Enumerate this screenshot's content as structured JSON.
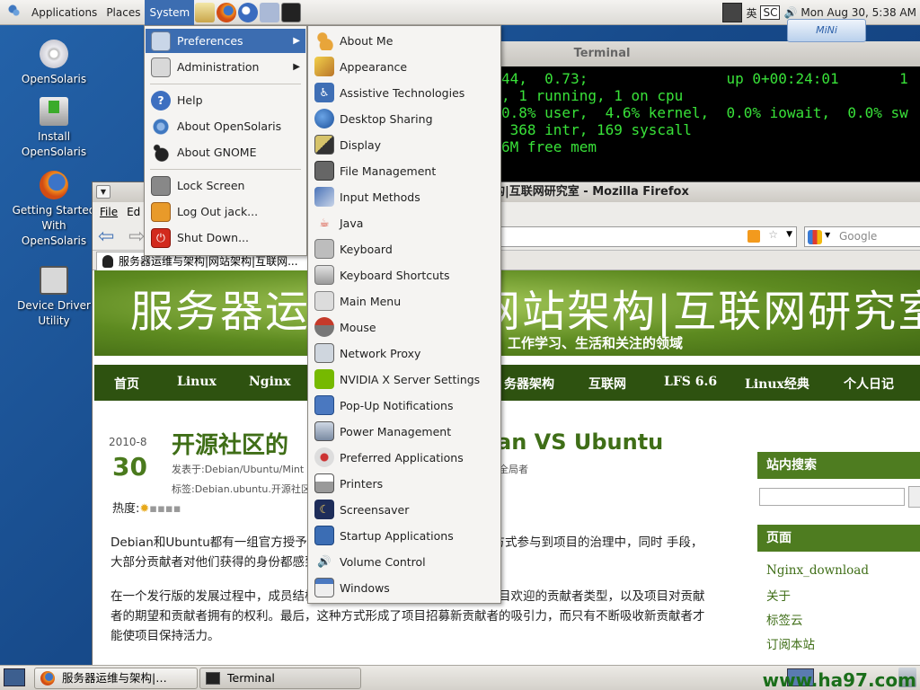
{
  "top_panel": {
    "applications_label": "Applications",
    "places_label": "Places",
    "system_label": "System",
    "ime_label": "英",
    "sc_label": "SC",
    "clock": "Mon Aug 30,  5:38 AM",
    "mini_label": "MiNi"
  },
  "desktop_icons": [
    {
      "label": "OpenSolaris",
      "icon": "cd-icon"
    },
    {
      "label": "Install OpenSolaris",
      "icon": "install-icon"
    },
    {
      "label": "Getting Started With OpenSolaris",
      "icon": "firefox-icon"
    },
    {
      "label": "Device Driver Utility",
      "icon": "device-driver-icon"
    }
  ],
  "terminal": {
    "title": "Terminal",
    "lines": [
      "44,  0.73;                up 0+00:24:01       1",
      ", 1 running, 1 on cpu",
      "0.8% user,  4.6% kernel,  0.0% iowait,  0.0% sw",
      " 368 intr, 169 syscall",
      "6M free mem"
    ]
  },
  "firefox": {
    "title_suffix": "构|互联网研究室 - Mozilla Firefox",
    "menu_file": "File",
    "menu_edit": "Ed",
    "search_placeholder": "Google",
    "tab_label": "服务器运维与架构|网站架构|互联网...",
    "site_title_left": "服务器运",
    "site_title_right": "网站架构|互联网研究室",
    "site_subtitle": "工作学习、生活和关注的领域",
    "nav": [
      "首页",
      "Linux",
      "Nginx",
      "务器架构",
      "互联网",
      "LFS 6.6",
      "Linux经典",
      "个人日记"
    ],
    "post_year_month": "2010-8",
    "post_day": "30",
    "post_title_left": "开源社区的",
    "post_title_right": "an VS Ubuntu",
    "post_meta_posted": "发表于:Debian/Ubuntu/Mint",
    "post_meta_tags": "标签:Debian.ubuntu.开源社区",
    "post_meta_author": "全局者",
    "post_heat_label": "热度:",
    "post_para1": "Debian和Ubuntu都有一组官方授予                          可以以参加选举或其他官方决策等方式参与到项目的治理中，同时                          手段，大部分贡献者对他们获得的身份都感到很自豪。",
    "post_para2": "在一个发行版的发展过程中，成员结构扮演中重要的角色：它定义了受项目欢迎的贡献者类型，以及项目对贡献者的期望和贡献者拥有的权利。最后，这种方式形成了项目招募新贡献者的吸引力，而只有不断吸收新贡献者才能使项目保持活力。",
    "sidebar_search_title": "站内搜索",
    "sidebar_pages_title": "页面",
    "sidebar_links": [
      "Nginx_download",
      "关于",
      "标签云",
      "订阅本站"
    ]
  },
  "system_menu": {
    "items": [
      {
        "label": "Preferences",
        "icon": "preferences-icon",
        "submenu": true
      },
      {
        "label": "Administration",
        "icon": "administration-icon",
        "submenu": true
      },
      {
        "label": "Help",
        "icon": "help-icon"
      },
      {
        "label": "About OpenSolaris",
        "icon": "about-opensolaris-icon"
      },
      {
        "label": "About GNOME",
        "icon": "gnome-foot-icon"
      },
      {
        "label": "Lock Screen",
        "icon": "lock-icon"
      },
      {
        "label": "Log Out jack...",
        "icon": "logout-icon"
      },
      {
        "label": "Shut Down...",
        "icon": "shutdown-icon"
      }
    ]
  },
  "preferences_menu": {
    "items": [
      {
        "label": "About Me",
        "icon": "about-me-icon"
      },
      {
        "label": "Appearance",
        "icon": "appearance-icon"
      },
      {
        "label": "Assistive Technologies",
        "icon": "accessibility-icon"
      },
      {
        "label": "Desktop Sharing",
        "icon": "desktop-sharing-icon"
      },
      {
        "label": "Display",
        "icon": "display-icon"
      },
      {
        "label": "File Management",
        "icon": "file-management-icon"
      },
      {
        "label": "Input Methods",
        "icon": "input-methods-icon"
      },
      {
        "label": "Java",
        "icon": "java-icon"
      },
      {
        "label": "Keyboard",
        "icon": "keyboard-icon"
      },
      {
        "label": "Keyboard Shortcuts",
        "icon": "keyboard-shortcuts-icon"
      },
      {
        "label": "Main Menu",
        "icon": "main-menu-icon"
      },
      {
        "label": "Mouse",
        "icon": "mouse-icon"
      },
      {
        "label": "Network Proxy",
        "icon": "network-proxy-icon"
      },
      {
        "label": "NVIDIA X Server Settings",
        "icon": "nvidia-icon"
      },
      {
        "label": "Pop-Up Notifications",
        "icon": "popup-notifications-icon"
      },
      {
        "label": "Power Management",
        "icon": "power-management-icon"
      },
      {
        "label": "Preferred Applications",
        "icon": "preferred-apps-icon"
      },
      {
        "label": "Printers",
        "icon": "printer-icon"
      },
      {
        "label": "Screensaver",
        "icon": "screensaver-icon"
      },
      {
        "label": "Startup Applications",
        "icon": "startup-apps-icon"
      },
      {
        "label": "Volume Control",
        "icon": "volume-icon"
      },
      {
        "label": "Windows",
        "icon": "windows-icon"
      }
    ]
  },
  "bottom_panel": {
    "task_firefox": "服务器运维与架构|…",
    "task_terminal": "Terminal",
    "watermark": "www.ha97.com"
  },
  "colors": {
    "menu_highlight": "#3c6db1",
    "terminal_text": "#39e239",
    "site_green": "#4e7c20"
  }
}
